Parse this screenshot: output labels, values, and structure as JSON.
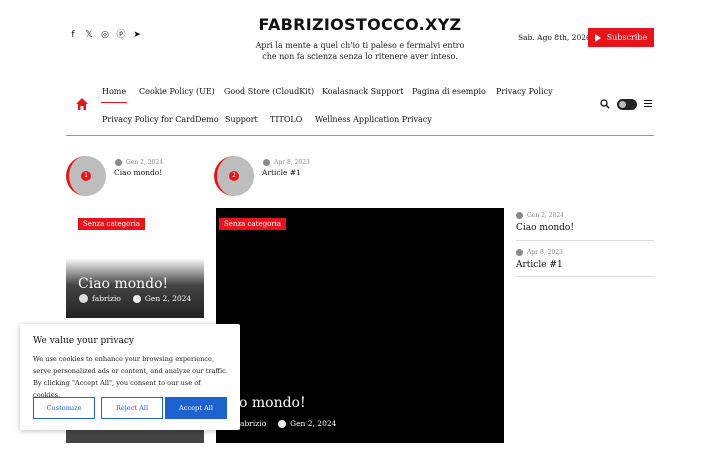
{
  "header": {
    "social_icons": [
      "facebook-icon",
      "x-icon",
      "instagram-icon",
      "pinterest-icon",
      "telegram-icon"
    ],
    "site_title": "FABRIZIOSTOCCO.XYZ",
    "tagline": "Apri la mente a quel ch'io ti paleso e fermalvi entro che non fa scienza senza lo ritenere aver inteso.",
    "date": "Sab. Ago 8th, 2026",
    "subscribe_label": "Subscribe"
  },
  "nav": {
    "items": [
      "Home",
      "Cookie Policy (UE)",
      "Good Store (CloudKit)",
      "Koalasnack Support",
      "Pagina di esempio",
      "Privacy Policy",
      "Privacy Policy for CardDemo",
      "Support",
      "TITOLO",
      "Wellness Application Privacy"
    ]
  },
  "featured": [
    {
      "number": "1",
      "date": "Gen 2, 2024",
      "title": "Ciao mondo!"
    },
    {
      "number": "2",
      "date": "Apr 8, 2023",
      "title": "Article #1"
    }
  ],
  "cards": {
    "left": {
      "category": "Senza categoria",
      "title": "Ciao mondo!",
      "author": "fabrizio",
      "date": "Gen 2, 2024"
    },
    "main": {
      "category": "Senza categoria",
      "title": "o mondo!",
      "author": "abrizio",
      "date": "Gen 2, 2024"
    }
  },
  "sidebar_posts": [
    {
      "date": "Gen 2, 2024",
      "title": "Ciao mondo!"
    },
    {
      "date": "Apr 8, 2023",
      "title": "Article #1"
    }
  ],
  "cookie": {
    "title": "We value your privacy",
    "text": "We use cookies to enhance your browsing experience, serve personalized ads or content, and analyze our traffic. By clicking \"Accept All\", you consent to our use of cookies.",
    "customize": "Customize",
    "reject": "Reject All",
    "accept": "Accept All"
  },
  "colors": {
    "accent": "#e8141a",
    "cookie_blue": "#1e62d0"
  }
}
